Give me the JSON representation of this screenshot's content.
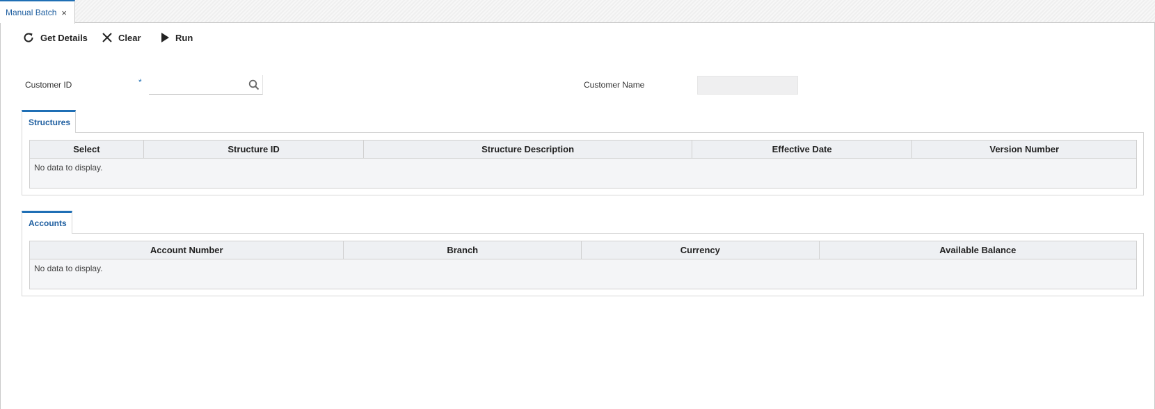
{
  "tab": {
    "title": "Manual Batch",
    "close_glyph": "×"
  },
  "toolbar": {
    "get_details": "Get Details",
    "clear": "Clear",
    "run": "Run"
  },
  "form": {
    "customer_id_label": "Customer ID",
    "required_marker": "*",
    "customer_id_value": "",
    "customer_name_label": "Customer Name",
    "customer_name_value": ""
  },
  "structures": {
    "tab_label": "Structures",
    "columns": [
      "Select",
      "Structure ID",
      "Structure Description",
      "Effective Date",
      "Version Number"
    ],
    "empty_text": "No data to display."
  },
  "accounts": {
    "tab_label": "Accounts",
    "columns": [
      "Account Number",
      "Branch",
      "Currency",
      "Available Balance"
    ],
    "empty_text": "No data to display."
  },
  "colors": {
    "accent": "#1f6fb5",
    "readonly_field": "#efeff0",
    "grid_header": "#eef0f3"
  }
}
